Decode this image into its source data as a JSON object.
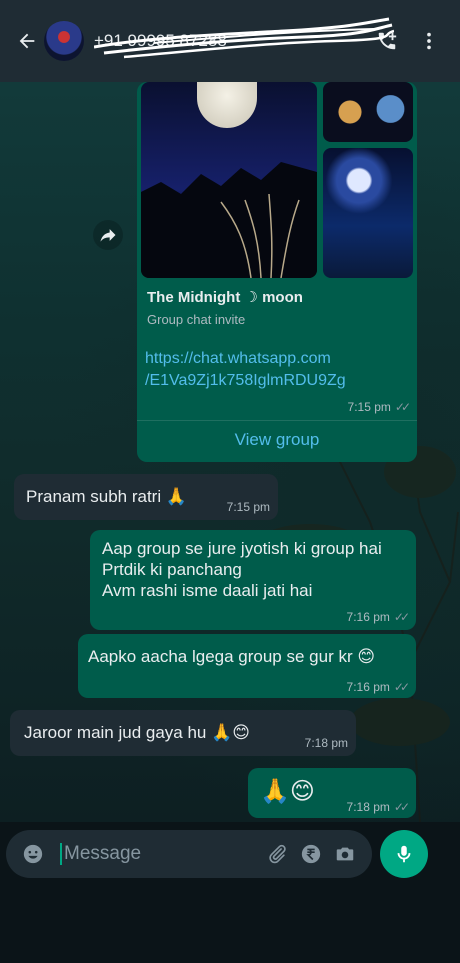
{
  "header": {
    "contact_name": "+91 99995 87288",
    "back_icon": "arrow-left-icon",
    "call_icon": "add-call-icon",
    "menu_icon": "more-vert-icon"
  },
  "invite": {
    "group_name": "The Midnight ☽ moon",
    "subtitle": "Group chat invite",
    "link_line1": "https://chat.whatsapp.com",
    "link_line2": "/E1Va9Zj1k758IglmRDU9Zg",
    "time": "7:15 pm",
    "view_label": "View group"
  },
  "messages": [
    {
      "dir": "in",
      "text": "Pranam subh ratri 🙏",
      "time": "7:15 pm"
    },
    {
      "dir": "out",
      "lines": [
        "Aap group se jure jyotish ki group hai",
        "Prtdik ki panchang",
        "Avm rashi isme daali jati hai"
      ],
      "time": "7:16 pm"
    },
    {
      "dir": "out",
      "text": "Aapko aacha lgega group se gur kr 😊",
      "time": "7:16 pm"
    },
    {
      "dir": "in",
      "text": "Jaroor main jud gaya hu 🙏😊",
      "time": "7:18 pm"
    },
    {
      "dir": "out",
      "text": "🙏😊",
      "time": "7:18 pm"
    }
  ],
  "input": {
    "placeholder": "Message",
    "emoji_icon": "emoji-icon",
    "attach_icon": "attach-icon",
    "payment_icon": "rupee-icon",
    "camera_icon": "camera-icon",
    "mic_icon": "mic-icon"
  },
  "colors": {
    "outgoing_bubble": "#005c4b",
    "incoming_bubble": "#1f2c34",
    "accent": "#00a884",
    "link": "#53bdeb"
  }
}
